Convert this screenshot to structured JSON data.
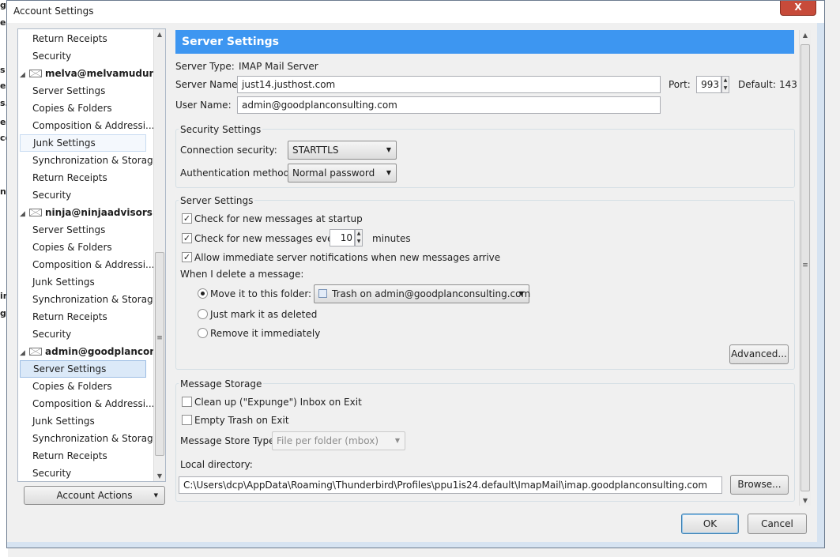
{
  "window": {
    "title": "Account Settings",
    "close_glyph": "X"
  },
  "background_fragments": [
    "g",
    "e",
    "s",
    "e",
    "s.",
    "e",
    "ce",
    "ng",
    "in",
    "g"
  ],
  "sidebar": {
    "items": [
      {
        "label": "Return Receipts",
        "type": "sub"
      },
      {
        "label": "Security",
        "type": "sub"
      },
      {
        "label": "melva@melvamudun...",
        "type": "account"
      },
      {
        "label": "Server Settings",
        "type": "sub"
      },
      {
        "label": "Copies & Folders",
        "type": "sub"
      },
      {
        "label": "Composition & Addressi...",
        "type": "sub"
      },
      {
        "label": "Junk Settings",
        "type": "sub",
        "state": "hover"
      },
      {
        "label": "Synchronization & Storage",
        "type": "sub"
      },
      {
        "label": "Return Receipts",
        "type": "sub"
      },
      {
        "label": "Security",
        "type": "sub"
      },
      {
        "label": "ninja@ninjaadvisors.c...",
        "type": "account"
      },
      {
        "label": "Server Settings",
        "type": "sub"
      },
      {
        "label": "Copies & Folders",
        "type": "sub"
      },
      {
        "label": "Composition & Addressi...",
        "type": "sub"
      },
      {
        "label": "Junk Settings",
        "type": "sub"
      },
      {
        "label": "Synchronization & Storage",
        "type": "sub"
      },
      {
        "label": "Return Receipts",
        "type": "sub"
      },
      {
        "label": "Security",
        "type": "sub"
      },
      {
        "label": "admin@goodplancon...",
        "type": "account"
      },
      {
        "label": "Server Settings",
        "type": "sub",
        "state": "selected"
      },
      {
        "label": "Copies & Folders",
        "type": "sub"
      },
      {
        "label": "Composition & Addressi...",
        "type": "sub"
      },
      {
        "label": "Junk Settings",
        "type": "sub"
      },
      {
        "label": "Synchronization & Storage",
        "type": "sub"
      },
      {
        "label": "Return Receipts",
        "type": "sub"
      },
      {
        "label": "Security",
        "type": "sub"
      }
    ],
    "account_actions_label": "Account Actions"
  },
  "main": {
    "header": "Server Settings",
    "server_type_label": "Server Type:",
    "server_type_value": "IMAP Mail Server",
    "server_name_label": "Server Name:",
    "server_name_value": "just14.justhost.com",
    "port_label": "Port:",
    "port_value": "993",
    "default_label": "Default:",
    "default_value": "143",
    "user_name_label": "User Name:",
    "user_name_value": "admin@goodplanconsulting.com",
    "security": {
      "title": "Security Settings",
      "connection_label": "Connection security:",
      "connection_value": "STARTTLS",
      "auth_label": "Authentication method:",
      "auth_value": "Normal password"
    },
    "server_settings": {
      "title": "Server Settings",
      "check_startup": "Check for new messages at startup",
      "check_every": "Check for new messages every",
      "interval_value": "10",
      "interval_unit": "minutes",
      "allow_notify": "Allow immediate server notifications when new messages arrive",
      "delete_label": "When I delete a message:",
      "move_label": "Move it to this folder:",
      "folder_value": "Trash on admin@goodplanconsulting.com",
      "mark_label": "Just mark it as deleted",
      "remove_label": "Remove it immediately",
      "advanced_label": "Advanced..."
    },
    "storage": {
      "title": "Message Storage",
      "cleanup_label": "Clean up (\"Expunge\") Inbox on Exit",
      "empty_trash_label": "Empty Trash on Exit",
      "store_type_label": "Message Store Type:",
      "store_type_value": "File per folder (mbox)",
      "local_dir_label": "Local directory:",
      "local_dir_value": "C:\\Users\\dcp\\AppData\\Roaming\\Thunderbird\\Profiles\\ppu1is24.default\\ImapMail\\imap.goodplanconsulting.com",
      "browse_label": "Browse..."
    }
  },
  "footer": {
    "ok_label": "OK",
    "cancel_label": "Cancel"
  }
}
